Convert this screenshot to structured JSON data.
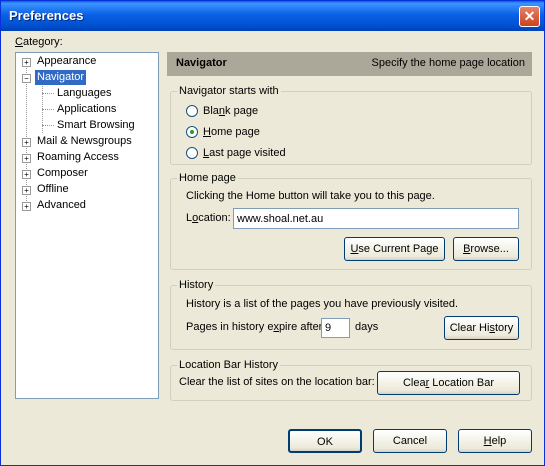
{
  "window": {
    "title": "Preferences",
    "close_label": "✕"
  },
  "category_label": "Category:",
  "tree": {
    "appearance": "Appearance",
    "navigator": "Navigator",
    "languages": "Languages",
    "applications": "Applications",
    "smart_browsing": "Smart Browsing",
    "mail": "Mail & Newsgroups",
    "roaming": "Roaming Access",
    "composer": "Composer",
    "offline": "Offline",
    "advanced": "Advanced"
  },
  "header": {
    "title": "Navigator",
    "subtitle": "Specify the home page location"
  },
  "starts_with": {
    "legend": "Navigator starts with",
    "blank": "Blank page",
    "home": "Home page",
    "last": "Last page visited",
    "selected": "home"
  },
  "homepage": {
    "legend": "Home page",
    "desc": "Clicking the Home button will take you to this page.",
    "location_label": "Location:",
    "location_value": "www.shoal.net.au",
    "use_current": "Use Current Page",
    "browse": "Browse..."
  },
  "history": {
    "legend": "History",
    "desc": "History is a list of the pages you have previously visited.",
    "expire_label": "Pages in history expire after:",
    "days_value": "9",
    "days_label": "days",
    "clear": "Clear History"
  },
  "location_bar": {
    "legend": "Location Bar History",
    "desc": "Clear the list of sites on the location bar:",
    "clear": "Clear Location Bar"
  },
  "footer": {
    "ok": "OK",
    "cancel": "Cancel",
    "help": "Help"
  }
}
